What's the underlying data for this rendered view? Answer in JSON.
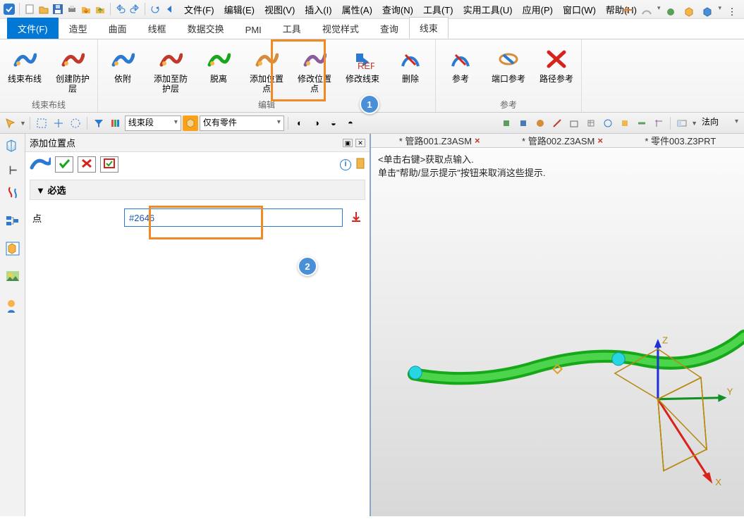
{
  "qat_menus": [
    "文件(F)",
    "编辑(E)",
    "视图(V)",
    "插入(I)",
    "属性(A)",
    "查询(N)",
    "工具(T)",
    "实用工具(U)",
    "应用(P)",
    "窗口(W)",
    "帮助(H)"
  ],
  "ribbon_tabs": [
    "文件(F)",
    "造型",
    "曲面",
    "线框",
    "数据交换",
    "PMI",
    "工具",
    "视觉样式",
    "查询",
    "线束"
  ],
  "ribbon_active": 0,
  "ribbon_hl": 9,
  "groups": {
    "g1": {
      "label": "线束布线",
      "items": [
        "线束布线",
        "创建防护层"
      ]
    },
    "g2": {
      "label": "编辑",
      "items": [
        "依附",
        "添加至防护层",
        "脱离",
        "添加位置点",
        "修改位置点",
        "修改线束",
        "删除"
      ]
    },
    "g3": {
      "label": "参考",
      "items": [
        "参考",
        "端口参考",
        "路径参考"
      ]
    }
  },
  "sel1": "线束段",
  "sel2": "仅有零件",
  "sel3": "法向",
  "panel": {
    "title": "添加位置点",
    "section": "必选",
    "field_label": "点",
    "field_value": "#2646"
  },
  "doctabs": [
    "* 管路001.Z3ASM",
    "* 管路002.Z3ASM",
    "* 零件003.Z3PRT"
  ],
  "hints": [
    "<单击右键>获取点输入.",
    "单击\"帮助/显示提示\"按钮来取消这些提示."
  ],
  "badges": {
    "b1": "1",
    "b2": "2"
  },
  "axes": {
    "x": "X",
    "y": "Y",
    "z": "Z"
  }
}
